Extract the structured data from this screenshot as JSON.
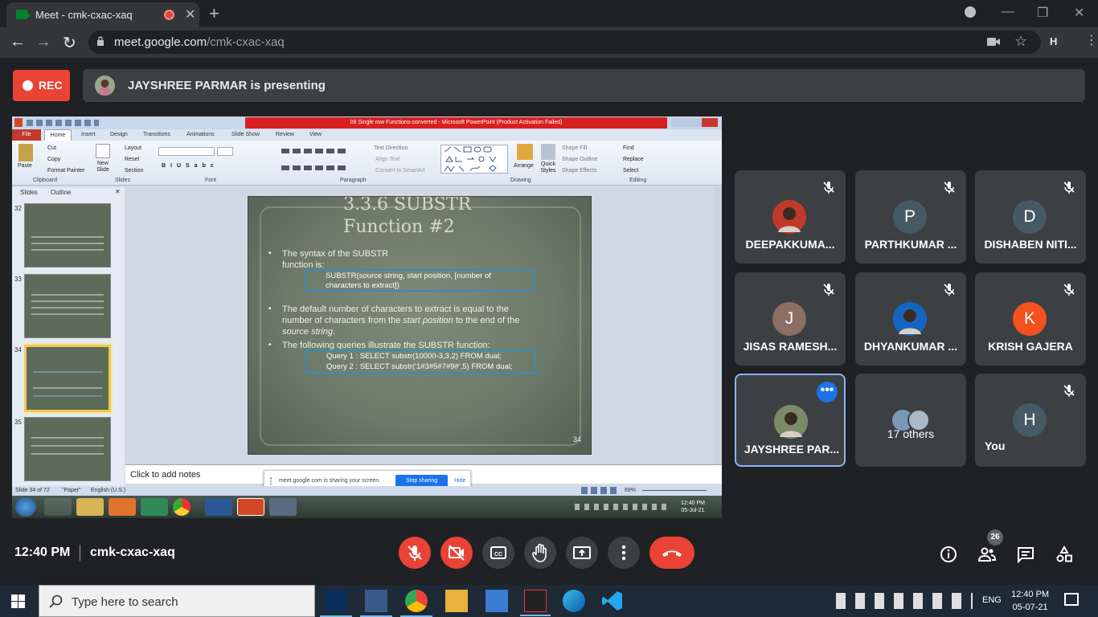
{
  "browser": {
    "tab_title": "Meet - cmk-cxac-xaq",
    "url_host": "meet.google.com",
    "url_path": "/cmk-cxac-xaq",
    "profile_initial": "H"
  },
  "meet": {
    "rec_label": "REC",
    "presenting_text": "JAYSHREE PARMAR is presenting",
    "time": "12:40 PM",
    "meeting_code": "cmk-cxac-xaq",
    "participant_count": "26",
    "participants": [
      {
        "name": "DEEPAKKUMA...",
        "initial": "",
        "color": "#c0392b",
        "muted": true,
        "photo": true
      },
      {
        "name": "PARTHKUMAR ...",
        "initial": "P",
        "color": "#455a64",
        "muted": true,
        "photo": false
      },
      {
        "name": "DISHABEN NITI...",
        "initial": "D",
        "color": "#455a64",
        "muted": true,
        "photo": false
      },
      {
        "name": "JISAS RAMESH...",
        "initial": "J",
        "color": "#8d6e63",
        "muted": true,
        "photo": false
      },
      {
        "name": "DHYANKUMAR ...",
        "initial": "",
        "color": "#1565c0",
        "muted": true,
        "photo": true
      },
      {
        "name": "KRISH GAJERA",
        "initial": "K",
        "color": "#f4511e",
        "muted": true,
        "photo": false
      },
      {
        "name": "JAYSHREE PAR...",
        "initial": "",
        "color": "#7b8b6a",
        "muted": false,
        "photo": true
      },
      {
        "name": "17 others",
        "initial": "",
        "color": "#6d8fb0",
        "muted": false,
        "photo": true
      },
      {
        "name": "You",
        "initial": "H",
        "color": "#455a64",
        "muted": true,
        "photo": false
      }
    ]
  },
  "ppt": {
    "window_title": "09 Single row Functions-converted - Microsoft PowerPoint (Product Activation Failed)",
    "tabs": [
      "File",
      "Home",
      "Insert",
      "Design",
      "Transitions",
      "Animations",
      "Slide Show",
      "Review",
      "View"
    ],
    "ribbon": {
      "cut": "Cut",
      "copy": "Copy",
      "format_painter": "Format Painter",
      "paste": "Paste",
      "new_slide": "New Slide",
      "layout": "Layout",
      "reset": "Reset",
      "section": "Section",
      "text_direction": "Text Direction",
      "align_text": "Align Text",
      "convert_smartart": "Convert to SmartArt",
      "arrange": "Arrange",
      "quick_styles": "Quick Styles",
      "shape_fill": "Shape Fill",
      "shape_outline": "Shape Outline",
      "shape_effects": "Shape Effects",
      "find": "Find",
      "replace": "Replace",
      "select": "Select",
      "groups": [
        "Clipboard",
        "Slides",
        "Font",
        "Paragraph",
        "Drawing",
        "Editing"
      ]
    },
    "pane_tabs": [
      "Slides",
      "Outline"
    ],
    "thumbs": [
      "32",
      "33",
      "34",
      "35"
    ],
    "slide": {
      "title_line1": "3.3.6 SUBSTR",
      "title_line2": "Function #2",
      "b1_line1": "The syntax of the SUBSTR",
      "b1_line2": "function is:",
      "syntax_line1": "SUBSTR(source string, start position, [number of",
      "syntax_line2": "characters to extract])",
      "b2_line1": "The default number of characters to extract is equal to the",
      "b2_line2a": "number  of  characters from the ",
      "b2_line2b": "start position",
      "b2_line2c": " to the end of the",
      "b2_line3": "source string",
      "b2_line3_end": ".",
      "b3": "The following queries illustrate the SUBSTR function:",
      "query1": "Query 1 :  SELECT substr(10000-3,3,2)  FROM dual;",
      "query2": "Query 2 :  SELECT substr('1#3#5#7#9#',5)  FROM dual;",
      "page": "34"
    },
    "notes_placeholder": "Click to add notes",
    "status_slide": "Slide 34 of 72",
    "status_theme": "\"Paper\"",
    "status_lang": "English (U.S.)",
    "zoom": "69%",
    "sharing_text": "meet.google.com is sharing your screen.",
    "stop_sharing": "Stop sharing",
    "hide": "Hide",
    "win7_time": "12:40 PM",
    "win7_date": "05-Jul-21"
  },
  "taskbar": {
    "search_placeholder": "Type here to search",
    "lang": "ENG",
    "time": "12:40 PM",
    "date": "05-07-21"
  },
  "colors": {
    "rec_red": "#ea4335",
    "active_tile_border": "#8ab4f8",
    "meet_blue": "#1a73e8"
  }
}
